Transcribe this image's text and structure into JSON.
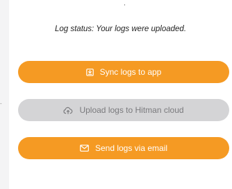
{
  "status": {
    "text": "Log status: Your logs were uploaded."
  },
  "buttons": {
    "sync": {
      "label": "Sync logs to app",
      "icon": "download-box-icon",
      "enabled": true
    },
    "upload": {
      "label": "Upload logs to Hitman cloud",
      "icon": "cloud-upload-icon",
      "enabled": false
    },
    "email": {
      "label": "Send logs via email",
      "icon": "envelope-icon",
      "enabled": true
    }
  },
  "colors": {
    "accent": "#f59a23",
    "disabled_bg": "#d4d4d6",
    "disabled_text": "#7a7a7d",
    "background": "#ffffff"
  }
}
